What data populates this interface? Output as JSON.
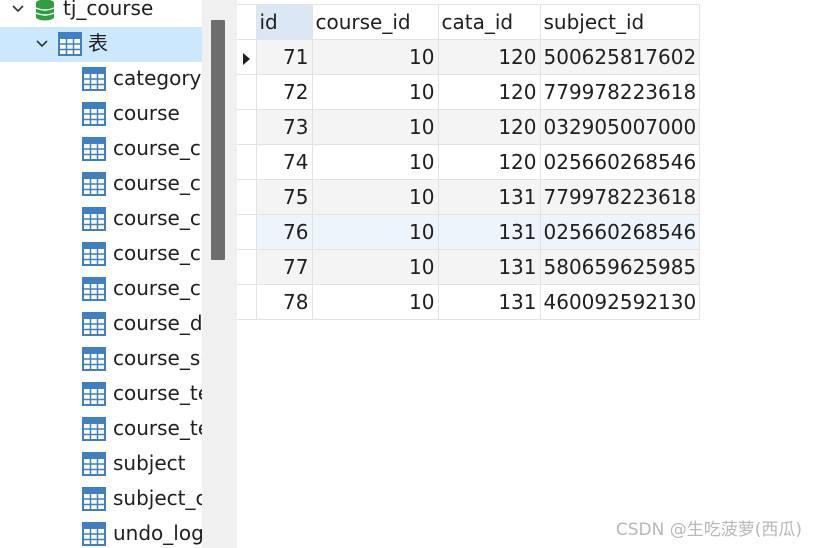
{
  "navigator": {
    "database": {
      "name": "tj_course",
      "icon": "database-icon"
    },
    "group": {
      "label": "表",
      "icon": "table-group-icon"
    },
    "tables": [
      "category",
      "course",
      "course_ca",
      "course_ca",
      "course_ca",
      "course_co",
      "course_co",
      "course_d",
      "course_su",
      "course_te",
      "course_te",
      "subject",
      "subject_c",
      "undo_log"
    ]
  },
  "grid": {
    "columns": [
      "id",
      "course_id",
      "cata_id",
      "subject_id"
    ],
    "rows": [
      {
        "id": "71",
        "course_id": "10",
        "cata_id": "120",
        "subject_id": "500625817602"
      },
      {
        "id": "72",
        "course_id": "10",
        "cata_id": "120",
        "subject_id": "779978223618"
      },
      {
        "id": "73",
        "course_id": "10",
        "cata_id": "120",
        "subject_id": "032905007000"
      },
      {
        "id": "74",
        "course_id": "10",
        "cata_id": "120",
        "subject_id": "025660268546"
      },
      {
        "id": "75",
        "course_id": "10",
        "cata_id": "131",
        "subject_id": "779978223618"
      },
      {
        "id": "76",
        "course_id": "10",
        "cata_id": "131",
        "subject_id": "025660268546"
      },
      {
        "id": "77",
        "course_id": "10",
        "cata_id": "131",
        "subject_id": "580659625985"
      },
      {
        "id": "78",
        "course_id": "10",
        "cata_id": "131",
        "subject_id": "460092592130"
      }
    ]
  },
  "watermark": "CSDN @生吃菠萝(西瓜)",
  "colors": {
    "selection": "#cce8ff",
    "db_icon_green": "#2e9e3f",
    "table_icon_blue": "#3f7fc4"
  }
}
